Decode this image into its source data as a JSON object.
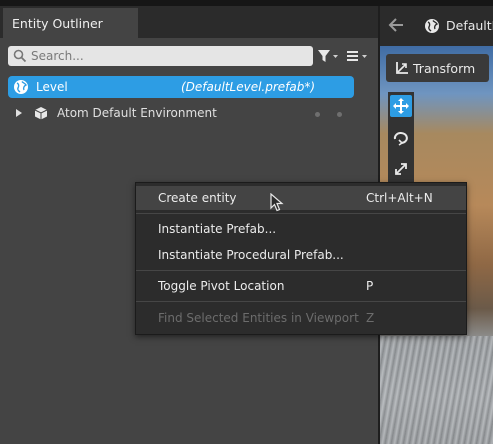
{
  "outliner": {
    "tab_title": "Entity Outliner",
    "search": {
      "placeholder": "Search..."
    },
    "filter_icon": "funnel-icon",
    "menu_icon": "list-menu-icon",
    "rows": {
      "level": {
        "label": "Level",
        "file": "(DefaultLevel.prefab*)",
        "icon": "globe-icon",
        "selected": true
      },
      "environment": {
        "label": "Atom Default Environment",
        "icon": "cube-icon",
        "expand_icon": "triangle-right-icon"
      }
    }
  },
  "viewport": {
    "back_icon": "arrow-left-icon",
    "level_label": "DefaultL",
    "transform_label": "Transform",
    "tools": [
      "move-icon",
      "rotate-icon",
      "scale-icon"
    ]
  },
  "context_menu": {
    "items": [
      {
        "label": "Create entity",
        "shortcut": "Ctrl+Alt+N",
        "hover": true,
        "enabled": true
      },
      {
        "label": "Instantiate Prefab...",
        "shortcut": "",
        "enabled": true
      },
      {
        "label": "Instantiate Procedural Prefab...",
        "shortcut": "",
        "enabled": true
      },
      {
        "label": "Toggle Pivot Location",
        "shortcut": "P",
        "enabled": true
      },
      {
        "label": "Find Selected Entities in Viewport",
        "shortcut": "Z",
        "enabled": false
      }
    ]
  },
  "colors": {
    "accent": "#2d9de4",
    "panel": "#444444",
    "menu_bg": "#2c2c2c",
    "menu_hover": "#444444"
  }
}
